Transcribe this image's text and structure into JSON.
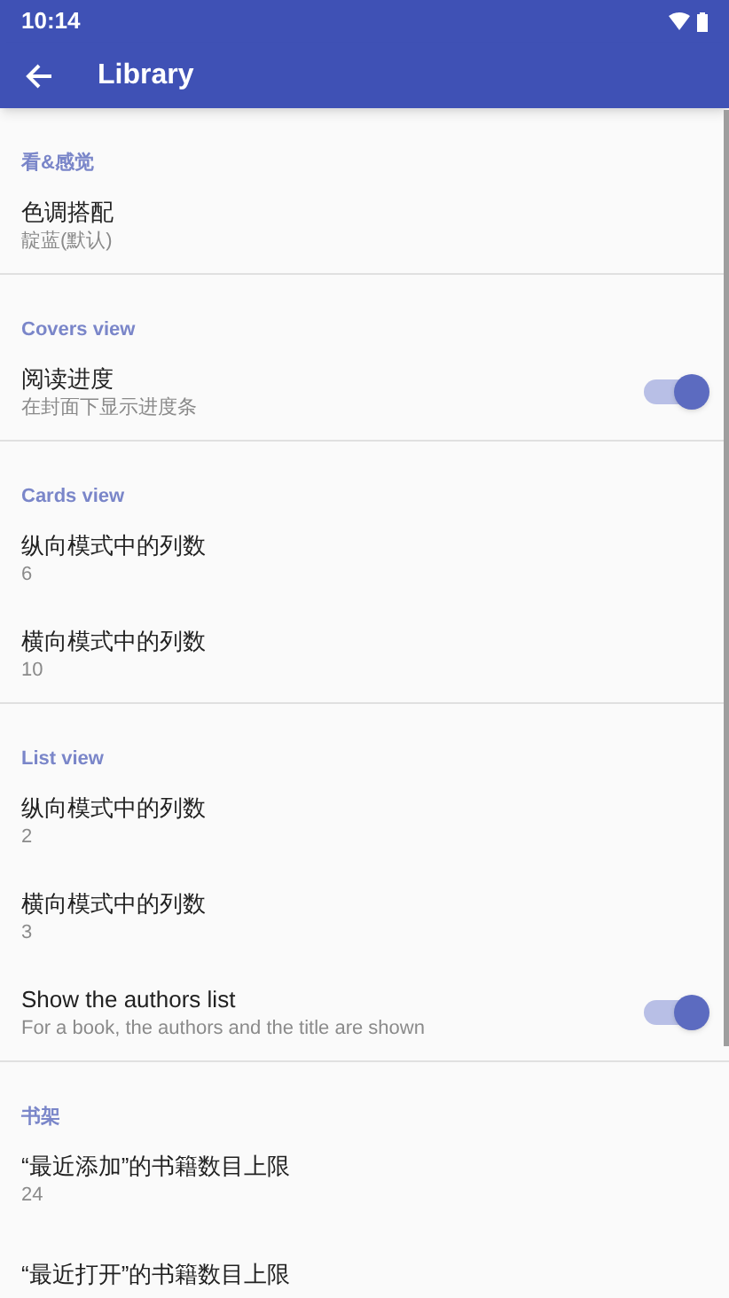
{
  "status_bar": {
    "time": "10:14"
  },
  "app_bar": {
    "title": "Library"
  },
  "sections": [
    {
      "header": "看&感觉",
      "items": [
        {
          "kind": "text",
          "title": "色调搭配",
          "summary": "靛蓝(默认)"
        }
      ]
    },
    {
      "header": "Covers view",
      "items": [
        {
          "kind": "switch",
          "title": "阅读进度",
          "summary": "在封面下显示进度条",
          "on": true
        }
      ]
    },
    {
      "header": "Cards view",
      "items": [
        {
          "kind": "text",
          "title": "纵向模式中的列数",
          "summary": "6"
        },
        {
          "kind": "text",
          "title": "横向模式中的列数",
          "summary": "10"
        }
      ]
    },
    {
      "header": "List view",
      "items": [
        {
          "kind": "text",
          "title": "纵向模式中的列数",
          "summary": "2"
        },
        {
          "kind": "text",
          "title": "横向模式中的列数",
          "summary": "3"
        },
        {
          "kind": "switch",
          "title": "Show the authors list",
          "summary": "For a book, the authors and the title are shown",
          "on": true
        }
      ]
    },
    {
      "header": "书架",
      "items": [
        {
          "kind": "text",
          "title": "“最近添加”的书籍数目上限",
          "summary": "24"
        },
        {
          "kind": "text",
          "title": "“最近打开”的书籍数目上限"
        }
      ]
    }
  ]
}
